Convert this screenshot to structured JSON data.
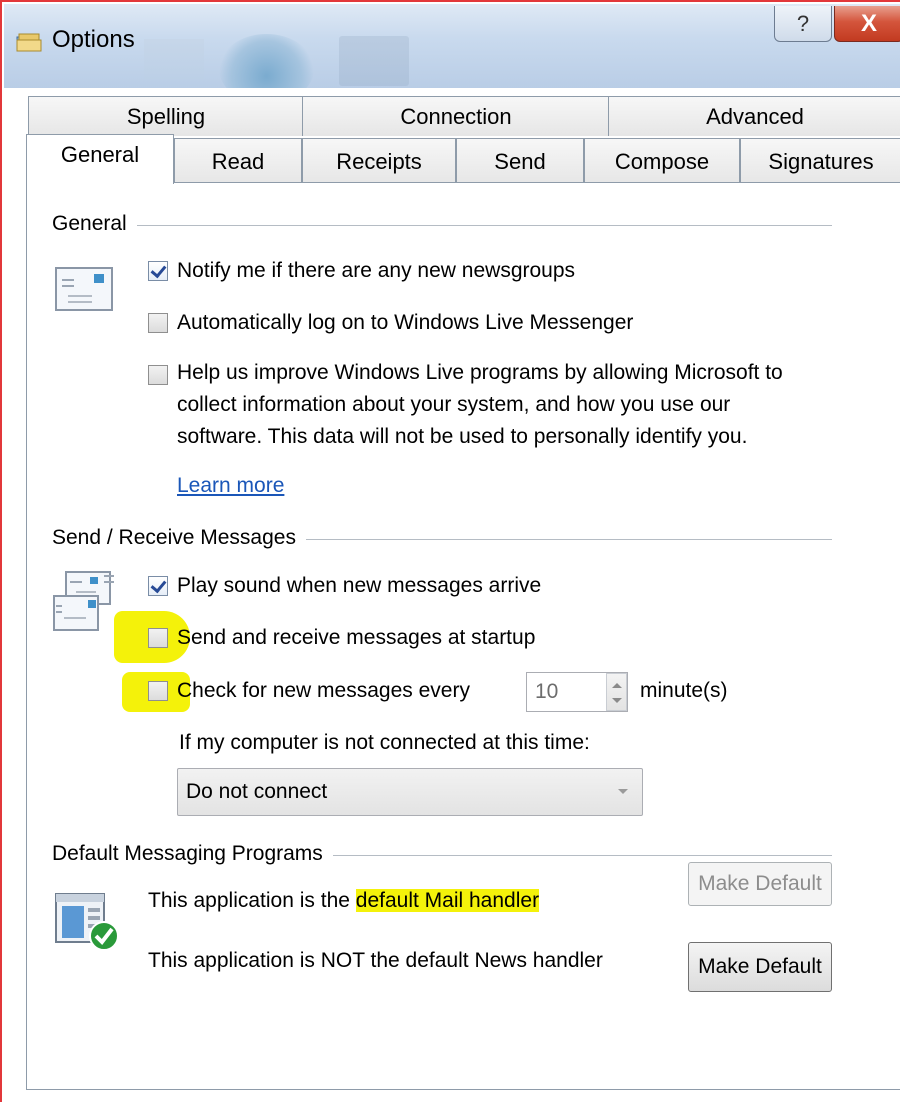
{
  "window": {
    "title": "Options",
    "help_glyph": "?",
    "close_glyph": "X"
  },
  "tabs": {
    "row1": [
      {
        "label": "Spelling"
      },
      {
        "label": "Connection"
      },
      {
        "label": "Advanced"
      }
    ],
    "row2": [
      {
        "label": "General",
        "active": true
      },
      {
        "label": "Read"
      },
      {
        "label": "Receipts"
      },
      {
        "label": "Send"
      },
      {
        "label": "Compose"
      },
      {
        "label": "Signatures"
      }
    ]
  },
  "general": {
    "title": "General",
    "icon": "newsgroup-icon",
    "notify_newsgroups": {
      "label": "Notify me if there are any new newsgroups",
      "checked": true
    },
    "auto_logon": {
      "label": "Automatically log on to Windows Live Messenger",
      "checked": false
    },
    "improve_program": {
      "label_lines": [
        "Help us improve Windows Live programs by allowing Microsoft to",
        "collect information about your system, and how you use our",
        "software. This data will not be used to personally identify you."
      ],
      "checked": false
    },
    "learn_more": "Learn more"
  },
  "send_receive": {
    "title": "Send / Receive Messages",
    "icon": "send-receive-icon",
    "play_sound": {
      "label": "Play sound when new messages arrive",
      "checked": true
    },
    "startup": {
      "label": "Send and receive messages at startup",
      "checked": false
    },
    "check_every": {
      "label": "Check for new messages every",
      "checked": false,
      "value": "10",
      "unit": "minute(s)"
    },
    "not_connected_label": "If my computer is not connected at this time:",
    "connect_option": "Do not connect"
  },
  "default_programs": {
    "title": "Default Messaging Programs",
    "icon": "default-app-check-icon",
    "mail_prefix": "This application is the ",
    "mail_highlight": "default Mail handler",
    "news_text": "This application is NOT the default News handler",
    "make_default_mail": "Make Default",
    "make_default_news": "Make Default"
  },
  "colors": {
    "highlight": "#f4f20a",
    "link": "#1a56b8",
    "border_red": "#e2373a"
  }
}
